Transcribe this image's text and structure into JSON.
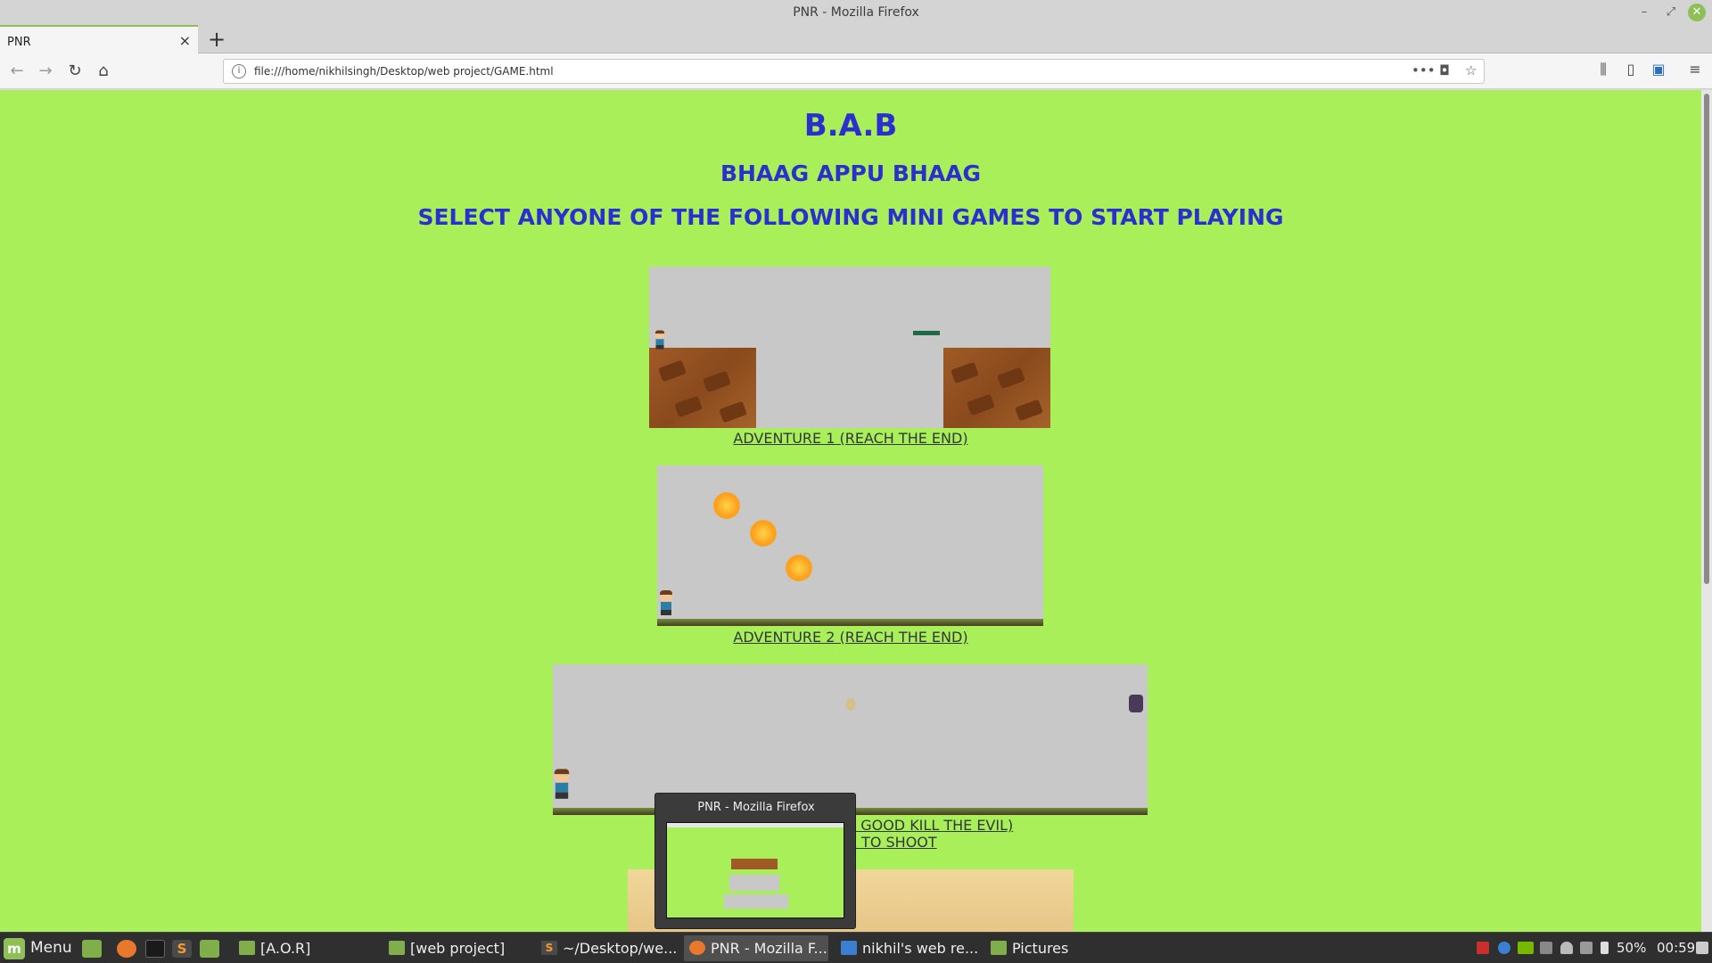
{
  "window": {
    "title": "PNR - Mozilla Firefox"
  },
  "tabs": [
    {
      "label": "PNR",
      "active": true
    }
  ],
  "navbar": {
    "url": "file:///home/nikhilsingh/Desktop/web project/GAME.html",
    "url_info_icon": "info-icon"
  },
  "page": {
    "background": "#a9ef59",
    "heading_color": "#2b2fd0",
    "title": "B.A.B",
    "subtitle": "BHAAG APPU BHAAG",
    "instruction": "SELECT ANYONE OF THE FOLLOWING MINI GAMES TO START PLAYING",
    "games": [
      {
        "link": "ADVENTURE 1 (REACH THE END)"
      },
      {
        "link": "ADVENTURE 2 (REACH THE END)"
      },
      {
        "link_visible_line1": "E GOOD KILL THE EVIL)",
        "link_visible_line2": "X TO SHOOT"
      }
    ]
  },
  "preview": {
    "title": "PNR - Mozilla Firefox"
  },
  "taskbar": {
    "menu_label": "Menu",
    "tasks": [
      {
        "label": "[A.O.R]",
        "icon": "folder-icon"
      },
      {
        "label": "[web project]",
        "icon": "folder-icon"
      },
      {
        "label": "~/Desktop/we...",
        "icon": "sublime-text-icon"
      },
      {
        "label": "PNR - Mozilla F...",
        "icon": "firefox-icon",
        "active": true
      },
      {
        "label": "nikhil's web re...",
        "icon": "document-icon"
      },
      {
        "label": "Pictures",
        "icon": "folder-icon"
      }
    ],
    "battery": "50%",
    "clock": "00:59"
  }
}
